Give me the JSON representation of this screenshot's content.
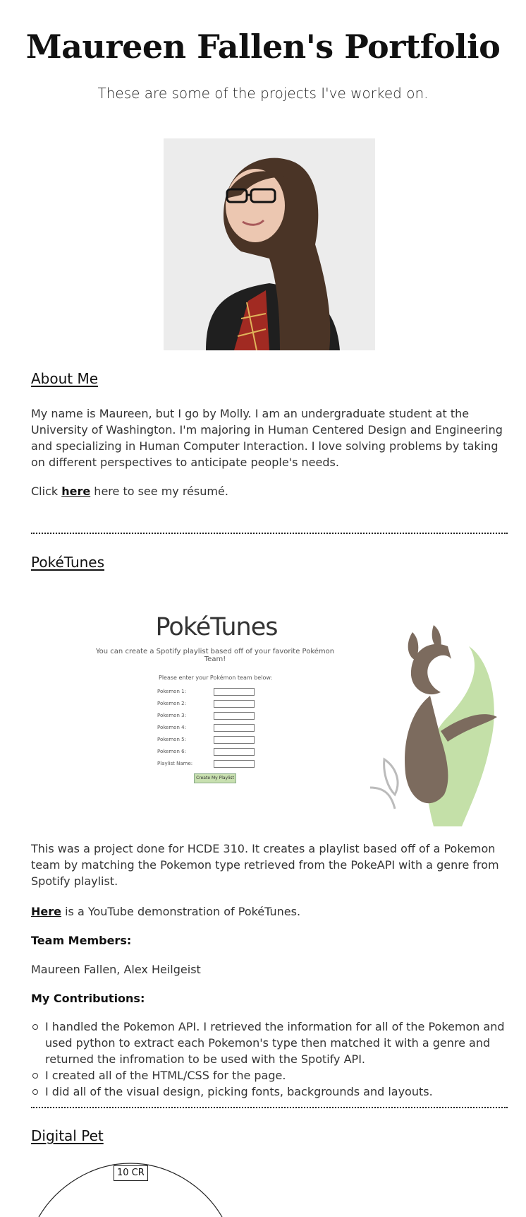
{
  "header": {
    "title": "Maureen Fallen's Portfolio",
    "subtitle": "These are some of the projects I've worked on."
  },
  "about": {
    "heading": "About Me",
    "bio": "My name is Maureen, but I go by Molly. I am an undergraduate student at the University of Washington. I'm majoring in Human Centered Design and Engineering and specializing in Human Computer Interaction. I love solving problems by taking on different perspectives to anticipate people's needs.",
    "resume_prefix": "Click",
    "resume_link": "here",
    "resume_suffix": "here to see my résumé."
  },
  "poketunes": {
    "heading": "PokéTunes",
    "screenshot": {
      "title": "PokéTunes",
      "subtitle": "You can create a Spotify playlist based off of your favorite Pokémon Team!",
      "form_heading": "Please enter your Pokémon team below:",
      "fields": [
        "Pokemon 1:",
        "Pokemon 2:",
        "Pokemon 3:",
        "Pokemon 4:",
        "Pokemon 5:",
        "Pokemon 6:",
        "Playlist Name:"
      ],
      "button": "Create My Playlist"
    },
    "description": "This was a project done for HCDE 310. It creates a playlist based off of a Pokemon team by matching the Pokemon type retrieved from the PokeAPI with a genre from Spotify playlist.",
    "demo_link": "Here",
    "demo_suffix": "is a YouTube demonstration of PokéTunes.",
    "team_label": "Team Members:",
    "team": "Maureen Fallen, Alex Heilgeist",
    "contrib_label": "My Contributions:",
    "contributions": [
      "I handled the Pokemon API. I retrieved the information for all of the Pokemon and used python to extract each Pokemon's type then matched it with a genre and returned the infromation to be used with the Spotify API.",
      "I created all of the HTML/CSS for the page.",
      "I did all of the visual design, picking fonts, backgrounds and layouts."
    ]
  },
  "digital_pet": {
    "heading": "Digital Pet",
    "badge": "10 CR"
  }
}
